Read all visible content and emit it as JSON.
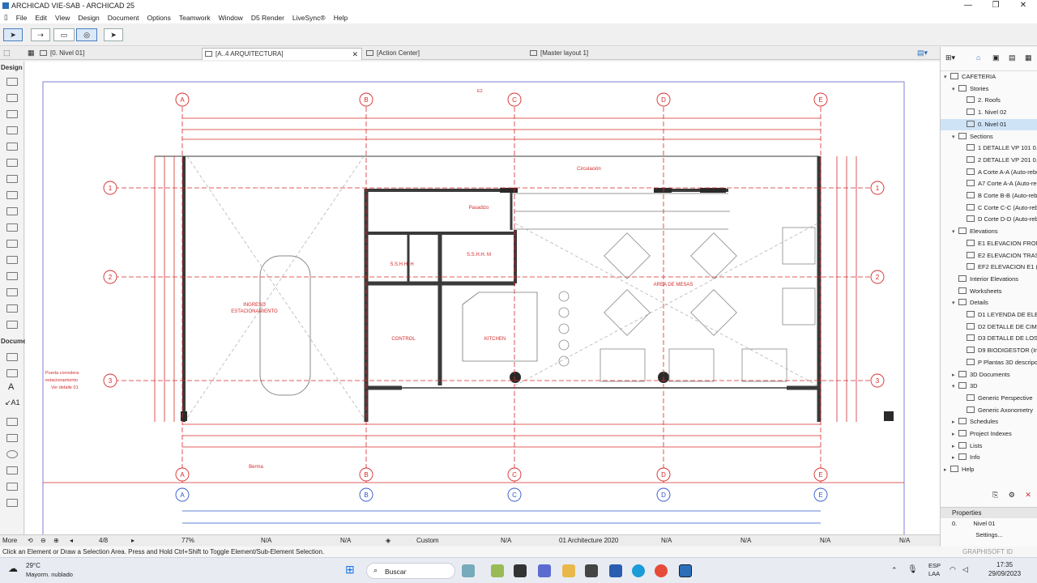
{
  "window": {
    "title": "ARCHICAD VIE-SAB - ARCHICAD 25"
  },
  "menu": [
    "File",
    "Edit",
    "View",
    "Design",
    "Document",
    "Options",
    "Teamwork",
    "Window",
    "D5 Render",
    "LiveSync®",
    "Help"
  ],
  "tabs": [
    {
      "label": "[0. Nivel 01]"
    },
    {
      "label": "[A..4 ARQUITECTURA]"
    },
    {
      "label": "[Action Center]"
    },
    {
      "label": "[Master layout 1]"
    }
  ],
  "toolbox": {
    "design_label": "Design",
    "document_label": "Docume",
    "more_label": "More"
  },
  "drawing": {
    "axes_letters": [
      "A",
      "B",
      "C",
      "D",
      "E"
    ],
    "axes_numbers": [
      "1",
      "2",
      "3"
    ],
    "rooms": [
      {
        "label": "INGRESO"
      },
      {
        "label": "ESTACIONAMIENTO"
      },
      {
        "label": "Circulación"
      },
      {
        "label": "Pasadizo"
      },
      {
        "label": "S.S.H.H. H"
      },
      {
        "label": "S.S.H.H. M"
      },
      {
        "label": "AREA DE MESAS"
      },
      {
        "label": "CONTROL"
      },
      {
        "label": "KITCHEN"
      },
      {
        "label": "Berma"
      }
    ],
    "note_lines": [
      "Puerta corredera",
      "estacionamiento",
      "Ver detalle 01"
    ],
    "marker_e2": "E2"
  },
  "navigator": {
    "project": "CAFETERIA",
    "items": [
      {
        "label": "CAFETERIA",
        "indent": 0,
        "toggle": "▾"
      },
      {
        "label": "Stories",
        "indent": 1,
        "toggle": "▾"
      },
      {
        "label": "2. Roofs",
        "indent": 2,
        "toggle": ""
      },
      {
        "label": "1. Nivel 02",
        "indent": 2,
        "toggle": ""
      },
      {
        "label": "0. Nivel 01",
        "indent": 2,
        "toggle": "",
        "selected": true
      },
      {
        "label": "Sections",
        "indent": 1,
        "toggle": "▾"
      },
      {
        "label": "1 DETALLE VP 101 0.20",
        "indent": 2,
        "toggle": ""
      },
      {
        "label": "2 DETALLE VP 201 0.20",
        "indent": 2,
        "toggle": ""
      },
      {
        "label": "A Corte A-A (Auto-rebu",
        "indent": 2,
        "toggle": ""
      },
      {
        "label": "A7 Corte A-A (Auto-rebu",
        "indent": 2,
        "toggle": ""
      },
      {
        "label": "B Corte B-B (Auto-rebu",
        "indent": 2,
        "toggle": ""
      },
      {
        "label": "C Corte C-C (Auto-rebu",
        "indent": 2,
        "toggle": ""
      },
      {
        "label": "D Corte D-D (Auto-rebu",
        "indent": 2,
        "toggle": ""
      },
      {
        "label": "Elevations",
        "indent": 1,
        "toggle": "▾"
      },
      {
        "label": "E1 ELEVACION FRONTA",
        "indent": 2,
        "toggle": ""
      },
      {
        "label": "E2 ELEVACION TRASER",
        "indent": 2,
        "toggle": ""
      },
      {
        "label": "EF2 ELEVACION E1 (Ma",
        "indent": 2,
        "toggle": ""
      },
      {
        "label": "Interior Elevations",
        "indent": 1,
        "toggle": ""
      },
      {
        "label": "Worksheets",
        "indent": 1,
        "toggle": ""
      },
      {
        "label": "Details",
        "indent": 1,
        "toggle": "▾"
      },
      {
        "label": "D1 LEYENDA DE ELECT",
        "indent": 2,
        "toggle": ""
      },
      {
        "label": "D2 DETALLE DE CIMEN",
        "indent": 2,
        "toggle": ""
      },
      {
        "label": "D3 DETALLE DE LOSAS",
        "indent": 2,
        "toggle": ""
      },
      {
        "label": "D9 BIODIGESTOR (Inde",
        "indent": 2,
        "toggle": ""
      },
      {
        "label": "P Plantas 3D descripci",
        "indent": 2,
        "toggle": ""
      },
      {
        "label": "3D Documents",
        "indent": 1,
        "toggle": "▸"
      },
      {
        "label": "3D",
        "indent": 1,
        "toggle": "▾"
      },
      {
        "label": "Generic Perspective",
        "indent": 2,
        "toggle": ""
      },
      {
        "label": "Generic Axonometry",
        "indent": 2,
        "toggle": ""
      },
      {
        "label": "Schedules",
        "indent": 1,
        "toggle": "▸"
      },
      {
        "label": "Project Indexes",
        "indent": 1,
        "toggle": "▸"
      },
      {
        "label": "Lists",
        "indent": 1,
        "toggle": "▸"
      },
      {
        "label": "Info",
        "indent": 1,
        "toggle": "▸"
      },
      {
        "label": "Help",
        "indent": 0,
        "toggle": "▸"
      }
    ]
  },
  "properties": {
    "header": "Properties",
    "story_num": "0.",
    "story_name": "Nivel 01",
    "settings": "Settings..."
  },
  "status": {
    "page": "4/8",
    "zoom": "77%",
    "na": "N/A",
    "custom": "Custom",
    "layer": "01 Architecture 2020"
  },
  "hint": "Click an Element or Draw a Selection Area. Press and Hold Ctrl+Shift to Toggle Element/Sub-Element Selection.",
  "graphisoft": "GRAPHISOFT ID",
  "taskbar": {
    "weather_temp": "29°C",
    "weather_desc": "Mayorm. nublado",
    "search": "Buscar",
    "lang1": "ESP",
    "lang2": "LAA",
    "time": "17:35",
    "date": "29/09/2023"
  },
  "colors": {
    "redline": "#d62a2a",
    "axis_blue": "#2f55c9",
    "wall": "#3a3a3a"
  }
}
